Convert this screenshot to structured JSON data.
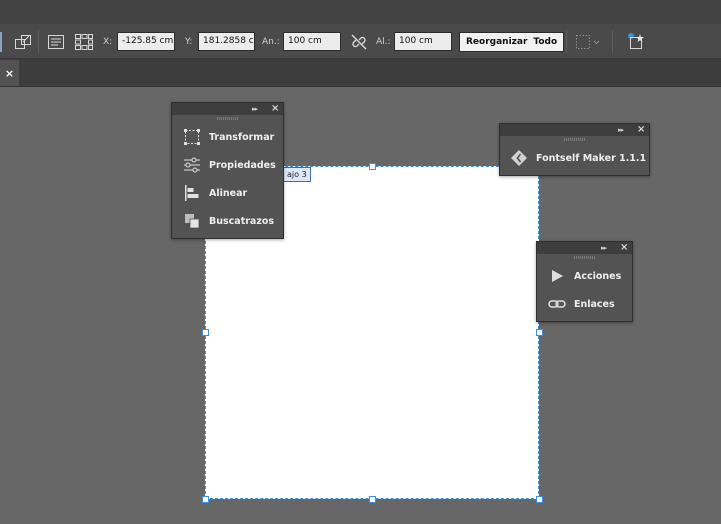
{
  "control_bar": {
    "x_label": "X:",
    "x_value": "-125.85 cm",
    "y_label": "Y:",
    "y_value": "181.2858 cm",
    "width_label": "An.:",
    "width_value": "100 cm",
    "height_label": "Al.:",
    "height_value": "100 cm",
    "rearrange_label": "Reorganizar",
    "all_label": "Todo"
  },
  "tab_bar": {
    "close_glyph": "×"
  },
  "artboard": {
    "label": "ajo 3",
    "fill": "#ffffff",
    "selection_color": "#3c8fd8"
  },
  "panel_left": {
    "collapse_glyph": "▸▸",
    "close_glyph": "×",
    "items": [
      {
        "label": "Transformar",
        "icon": "transform-icon"
      },
      {
        "label": "Propiedades",
        "icon": "properties-icon"
      },
      {
        "label": "Alinear",
        "icon": "align-icon"
      },
      {
        "label": "Buscatrazos",
        "icon": "pathfinder-icon"
      }
    ]
  },
  "panel_fontself": {
    "collapse_glyph": "▸▸",
    "close_glyph": "×",
    "items": [
      {
        "label": "Fontself Maker 1.1.1",
        "icon": "fontself-icon"
      }
    ]
  },
  "panel_actions": {
    "collapse_glyph": "▸▸",
    "close_glyph": "×",
    "items": [
      {
        "label": "Acciones",
        "icon": "play-icon"
      },
      {
        "label": "Enlaces",
        "icon": "link-icon"
      }
    ]
  },
  "colors": {
    "canvas": "#676767",
    "panel": "#535353",
    "controlbar": "#4a4a4a"
  }
}
